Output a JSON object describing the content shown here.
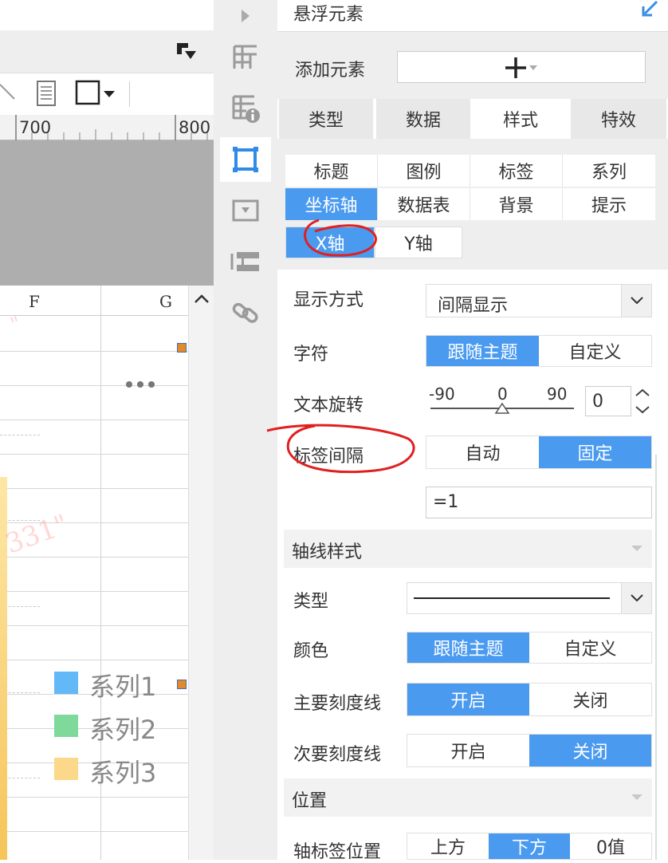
{
  "ruler": {
    "label_a": "700",
    "label_b": "800"
  },
  "sheet": {
    "col_f": "F",
    "col_g": "G"
  },
  "legend": [
    {
      "label": "系列1",
      "color": "#63b8f7"
    },
    {
      "label": "系列2",
      "color": "#7fd99a"
    },
    {
      "label": "系列3",
      "color": "#fcd98a"
    }
  ],
  "watermark": {
    "text": "331\""
  },
  "panel": {
    "header_title": "悬浮元素",
    "add_element_label": "添加元素",
    "main_tabs": [
      "类型",
      "数据",
      "样式",
      "特效"
    ],
    "sub_tabs_row1": [
      "标题",
      "图例",
      "标签",
      "系列"
    ],
    "sub_tabs_row2": [
      "坐标轴",
      "数据表",
      "背景",
      "提示"
    ],
    "axis_tabs": [
      "X轴",
      "Y轴"
    ],
    "display_mode": {
      "label": "显示方式",
      "value": "间隔显示"
    },
    "chars": {
      "label": "字符",
      "options": [
        "跟随主题",
        "自定义"
      ]
    },
    "rotation": {
      "label": "文本旋转",
      "min": "-90",
      "mid": "0",
      "max": "90",
      "value": "0"
    },
    "interval": {
      "label": "标签间隔",
      "options": [
        "自动",
        "固定"
      ],
      "value": "=1"
    },
    "axis_style_section": "轴线样式",
    "line_type": {
      "label": "类型"
    },
    "color": {
      "label": "颜色",
      "options": [
        "跟随主题",
        "自定义"
      ]
    },
    "major_tick": {
      "label": "主要刻度线",
      "options": [
        "开启",
        "关闭"
      ]
    },
    "minor_tick": {
      "label": "次要刻度线",
      "options": [
        "开启",
        "关闭"
      ]
    },
    "position_section": "位置",
    "label_position": {
      "label": "轴标签位置",
      "options": [
        "上方",
        "下方",
        "0值"
      ]
    },
    "accent_color": "#4a9af0"
  }
}
